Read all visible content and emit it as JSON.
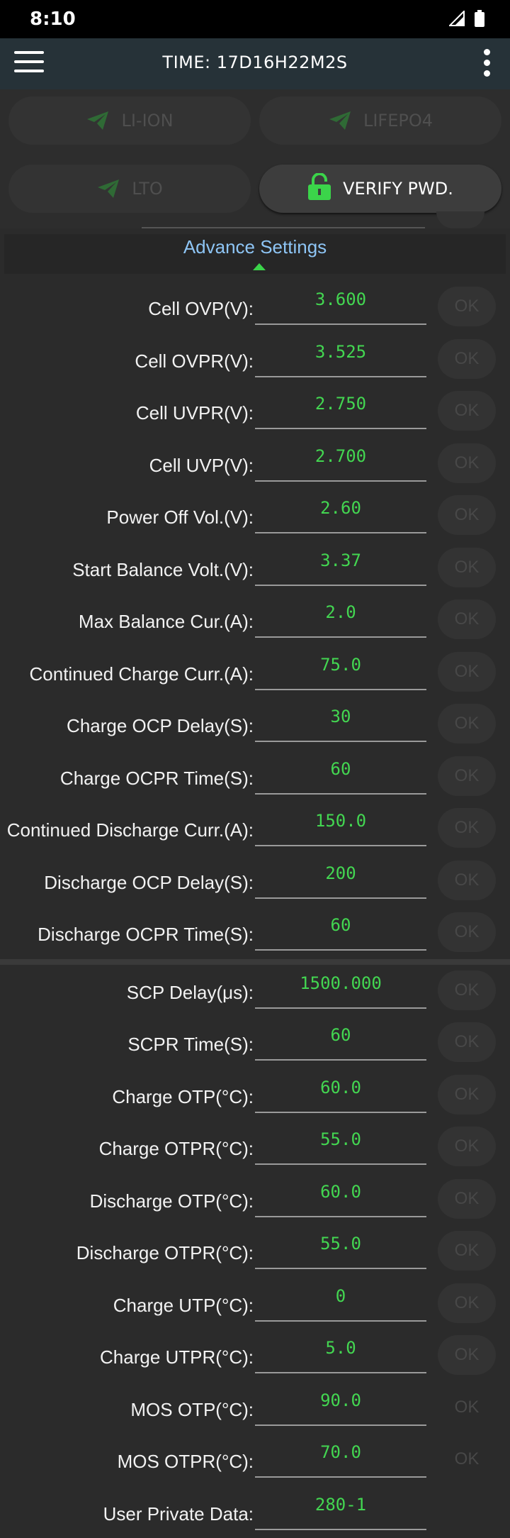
{
  "status_bar": {
    "time": "8:10"
  },
  "app_bar": {
    "title": "TIME: 17D16H22M2S"
  },
  "presets": {
    "li_ion": "LI-ION",
    "lifepo4": "LIFEPO4",
    "lto": "LTO",
    "verify": "VERIFY PWD."
  },
  "settings": {
    "header": "Advance Settings",
    "ok_label": "OK",
    "rows": [
      {
        "label": "Cell OVP(V):",
        "value": "3.600"
      },
      {
        "label": "Cell OVPR(V):",
        "value": "3.525"
      },
      {
        "label": "Cell UVPR(V):",
        "value": "2.750"
      },
      {
        "label": "Cell UVP(V):",
        "value": "2.700"
      },
      {
        "label": "Power Off Vol.(V):",
        "value": "2.60"
      },
      {
        "label": "Start Balance Volt.(V):",
        "value": "3.37"
      },
      {
        "label": "Max Balance Cur.(A):",
        "value": "2.0"
      },
      {
        "label": "Continued Charge Curr.(A):",
        "value": "75.0"
      },
      {
        "label": "Charge OCP Delay(S):",
        "value": "30"
      },
      {
        "label": "Charge OCPR Time(S):",
        "value": "60"
      },
      {
        "label": "Continued Discharge Curr.(A):",
        "value": "150.0"
      },
      {
        "label": "Discharge OCP Delay(S):",
        "value": "200"
      },
      {
        "label": "Discharge OCPR Time(S):",
        "value": "60"
      },
      {
        "label": "SCP Delay(μs):",
        "value": "1500.000"
      },
      {
        "label": "SCPR Time(S):",
        "value": "60"
      },
      {
        "label": "Charge OTP(°C):",
        "value": "60.0"
      },
      {
        "label": "Charge OTPR(°C):",
        "value": "55.0"
      },
      {
        "label": "Discharge OTP(°C):",
        "value": "60.0"
      },
      {
        "label": "Discharge OTPR(°C):",
        "value": "55.0"
      },
      {
        "label": "Charge UTP(°C):",
        "value": "0"
      },
      {
        "label": "Charge UTPR(°C):",
        "value": "5.0"
      },
      {
        "label": "MOS OTP(°C):",
        "value": "90.0"
      },
      {
        "label": "MOS OTPR(°C):",
        "value": "70.0"
      },
      {
        "label": "User Private Data:",
        "value": "280-1"
      }
    ]
  }
}
